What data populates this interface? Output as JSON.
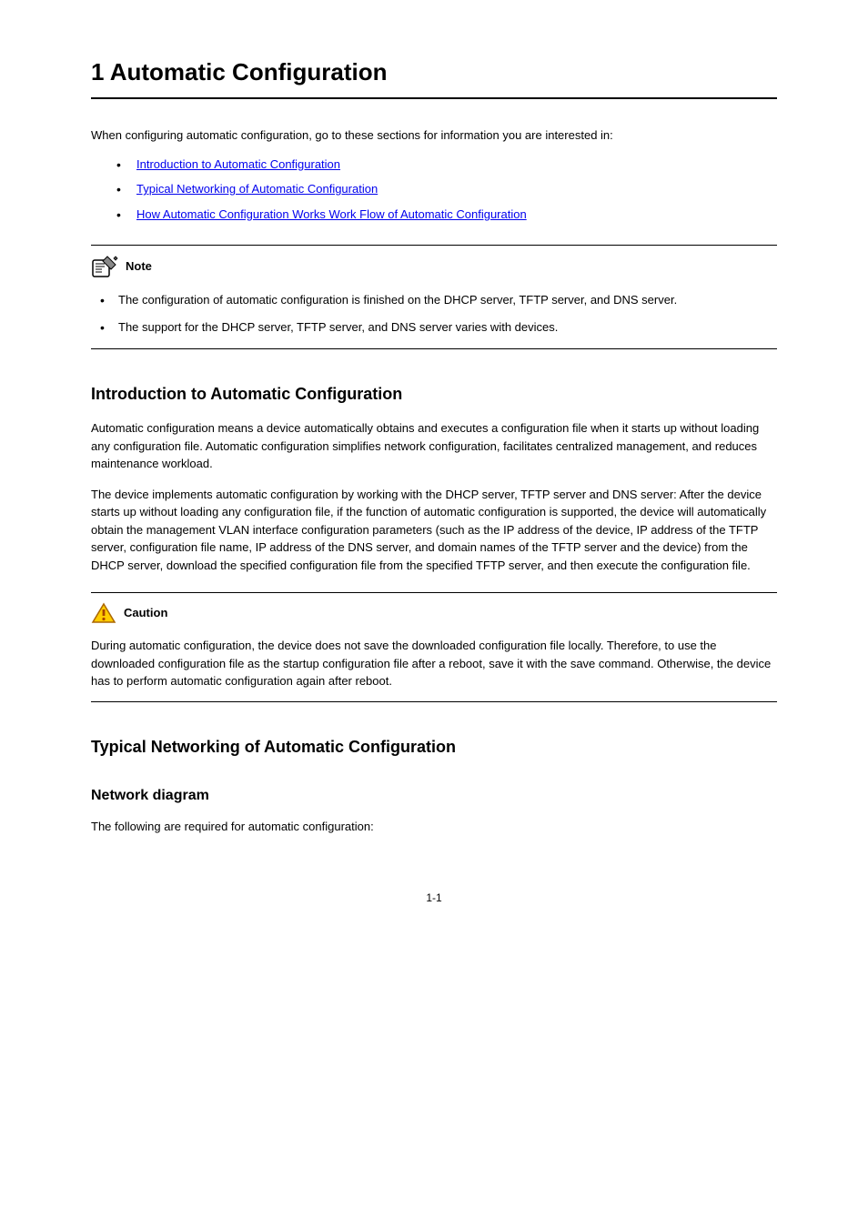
{
  "chapter": {
    "title": "1 Automatic Configuration"
  },
  "toc": {
    "intro": "When configuring automatic configuration, go to these sections for information you are interested in:",
    "items": [
      "Introduction to Automatic Configuration",
      "Typical Networking of Automatic Configuration",
      "How Automatic Configuration Works Work Flow of Automatic Configuration"
    ]
  },
  "note": {
    "label": "Note",
    "items": [
      "The configuration of automatic configuration is finished on the DHCP server, TFTP server, and DNS server.",
      "The support for the DHCP server, TFTP server, and DNS server varies with devices."
    ]
  },
  "section1": {
    "title": "Introduction to Automatic Configuration",
    "p1": "Automatic configuration means a device automatically obtains and executes a configuration file when it starts up without loading any configuration file. Automatic configuration simplifies network configuration, facilitates centralized management, and reduces maintenance workload.",
    "p2": "The device implements automatic configuration by working with the DHCP server, TFTP server and DNS server: After the device starts up without loading any configuration file, if the function of automatic configuration is supported, the device will automatically obtain the management VLAN interface configuration parameters (such as the IP address of the device, IP address of the TFTP server, configuration file name, IP address of the DNS server, and domain names of the TFTP server and the device) from the DHCP server, download the specified configuration file from the specified TFTP server, and then execute the configuration file."
  },
  "caution": {
    "label": "Caution",
    "body": "During automatic configuration, the device does not save the downloaded configuration file locally. Therefore, to use the downloaded configuration file as the startup configuration file after a reboot, save it with the save command. Otherwise, the device has to perform automatic configuration again after reboot."
  },
  "section2": {
    "title": "Typical Networking of Automatic Configuration",
    "p1": "The following are required for automatic configuration:"
  },
  "pageNumber": "1-1"
}
